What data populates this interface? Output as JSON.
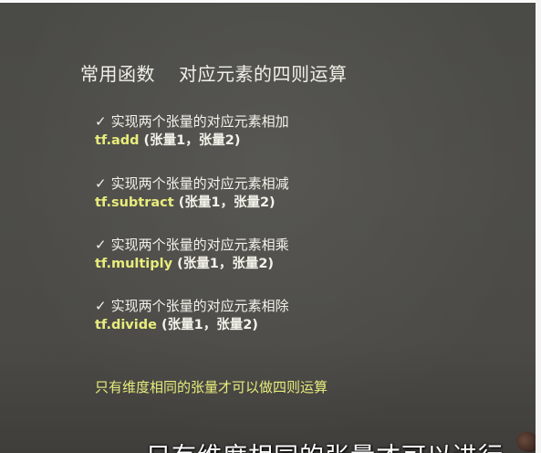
{
  "slide": {
    "title": "常用函数",
    "title_sub": "对应元素的四则运算",
    "items": [
      {
        "check": "✓",
        "desc": "实现两个张量的对应元素相加",
        "fn": "tf.add",
        "args": " (张量1，张量2)"
      },
      {
        "check": "✓",
        "desc": "实现两个张量的对应元素相减",
        "fn": "tf.subtract",
        "args": " (张量1，张量2)"
      },
      {
        "check": "✓",
        "desc": "实现两个张量的对应元素相乘",
        "fn": "tf.multiply",
        "args": " (张量1，张量2)"
      },
      {
        "check": "✓",
        "desc": "实现两个张量的对应元素相除",
        "fn": "tf.divide",
        "args": " (张量1，张量2)"
      }
    ],
    "note": "只有维度相同的张量才可以做四则运算"
  },
  "video": {
    "subtitle": "只有维度相同的张量才可以进行"
  },
  "colors": {
    "slide_bg": "#4b4a46",
    "text": "#f3f2ea",
    "highlight": "#e8ec7c"
  }
}
